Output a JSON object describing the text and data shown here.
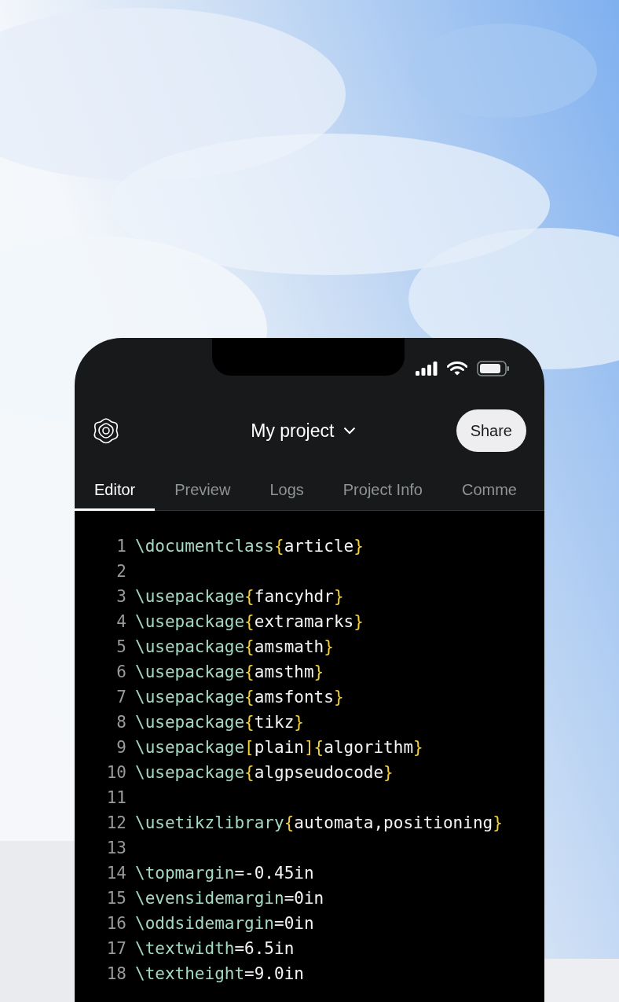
{
  "header": {
    "title": "My project",
    "share_button": "Share"
  },
  "tabs": [
    {
      "label": "Editor",
      "selected": true
    },
    {
      "label": "Preview",
      "selected": false
    },
    {
      "label": "Logs",
      "selected": false
    },
    {
      "label": "Project Info",
      "selected": false
    },
    {
      "label": "Comme",
      "selected": false
    }
  ],
  "editor": {
    "lines": [
      {
        "number": "1",
        "tokens": [
          {
            "kind": "command",
            "text": "\\documentclass"
          },
          {
            "kind": "bracket",
            "text": "{"
          },
          {
            "kind": "arg",
            "text": "article"
          },
          {
            "kind": "bracket",
            "text": "}"
          }
        ]
      },
      {
        "number": "2"
      },
      {
        "number": "3",
        "tokens": [
          {
            "kind": "command",
            "text": "\\usepackage"
          },
          {
            "kind": "bracket",
            "text": "{"
          },
          {
            "kind": "arg",
            "text": "fancyhdr"
          },
          {
            "kind": "bracket",
            "text": "}"
          }
        ]
      },
      {
        "number": "4",
        "tokens": [
          {
            "kind": "command",
            "text": "\\usepackage"
          },
          {
            "kind": "bracket",
            "text": "{"
          },
          {
            "kind": "arg",
            "text": "extramarks"
          },
          {
            "kind": "bracket",
            "text": "}"
          }
        ]
      },
      {
        "number": "5",
        "tokens": [
          {
            "kind": "command",
            "text": "\\usepackage"
          },
          {
            "kind": "bracket",
            "text": "{"
          },
          {
            "kind": "arg",
            "text": "amsmath"
          },
          {
            "kind": "bracket",
            "text": "}"
          }
        ]
      },
      {
        "number": "6",
        "tokens": [
          {
            "kind": "command",
            "text": "\\usepackage"
          },
          {
            "kind": "bracket",
            "text": "{"
          },
          {
            "kind": "arg",
            "text": "amsthm"
          },
          {
            "kind": "bracket",
            "text": "}"
          }
        ]
      },
      {
        "number": "7",
        "tokens": [
          {
            "kind": "command",
            "text": "\\usepackage"
          },
          {
            "kind": "bracket",
            "text": "{"
          },
          {
            "kind": "arg",
            "text": "amsfonts"
          },
          {
            "kind": "bracket",
            "text": "}"
          }
        ]
      },
      {
        "number": "8",
        "tokens": [
          {
            "kind": "command",
            "text": "\\usepackage"
          },
          {
            "kind": "bracket",
            "text": "{"
          },
          {
            "kind": "arg",
            "text": "tikz"
          },
          {
            "kind": "bracket",
            "text": "}"
          }
        ]
      },
      {
        "number": "9",
        "tokens": [
          {
            "kind": "command",
            "text": "\\usepackage"
          },
          {
            "kind": "bracket",
            "text": "["
          },
          {
            "kind": "arg",
            "text": "plain"
          },
          {
            "kind": "bracket",
            "text": "]{"
          },
          {
            "kind": "arg",
            "text": "algorithm"
          },
          {
            "kind": "bracket",
            "text": "}"
          }
        ]
      },
      {
        "number": "10",
        "tokens": [
          {
            "kind": "command",
            "text": "\\usepackage"
          },
          {
            "kind": "bracket",
            "text": "{"
          },
          {
            "kind": "arg",
            "text": "algpseudocode"
          },
          {
            "kind": "bracket",
            "text": "}"
          }
        ]
      },
      {
        "number": "11"
      },
      {
        "number": "12",
        "tokens": [
          {
            "kind": "command",
            "text": "\\usetikzlibrary"
          },
          {
            "kind": "bracket",
            "text": "{"
          },
          {
            "kind": "arg",
            "text": "automata,positioning"
          },
          {
            "kind": "bracket",
            "text": "}"
          }
        ]
      },
      {
        "number": "13"
      },
      {
        "number": "14",
        "tokens": [
          {
            "kind": "command",
            "text": "\\topmargin"
          },
          {
            "kind": "arg",
            "text": "=-0.45in"
          }
        ]
      },
      {
        "number": "15",
        "tokens": [
          {
            "kind": "command",
            "text": "\\evensidemargin"
          },
          {
            "kind": "arg",
            "text": "=0in"
          }
        ]
      },
      {
        "number": "16",
        "tokens": [
          {
            "kind": "command",
            "text": "\\oddsidemargin"
          },
          {
            "kind": "arg",
            "text": "=0in"
          }
        ]
      },
      {
        "number": "17",
        "tokens": [
          {
            "kind": "command",
            "text": "\\textwidth"
          },
          {
            "kind": "arg",
            "text": "=6.5in"
          }
        ]
      },
      {
        "number": "18",
        "tokens": [
          {
            "kind": "command",
            "text": "\\textheight"
          },
          {
            "kind": "arg",
            "text": "=9.0in"
          }
        ]
      }
    ]
  }
}
